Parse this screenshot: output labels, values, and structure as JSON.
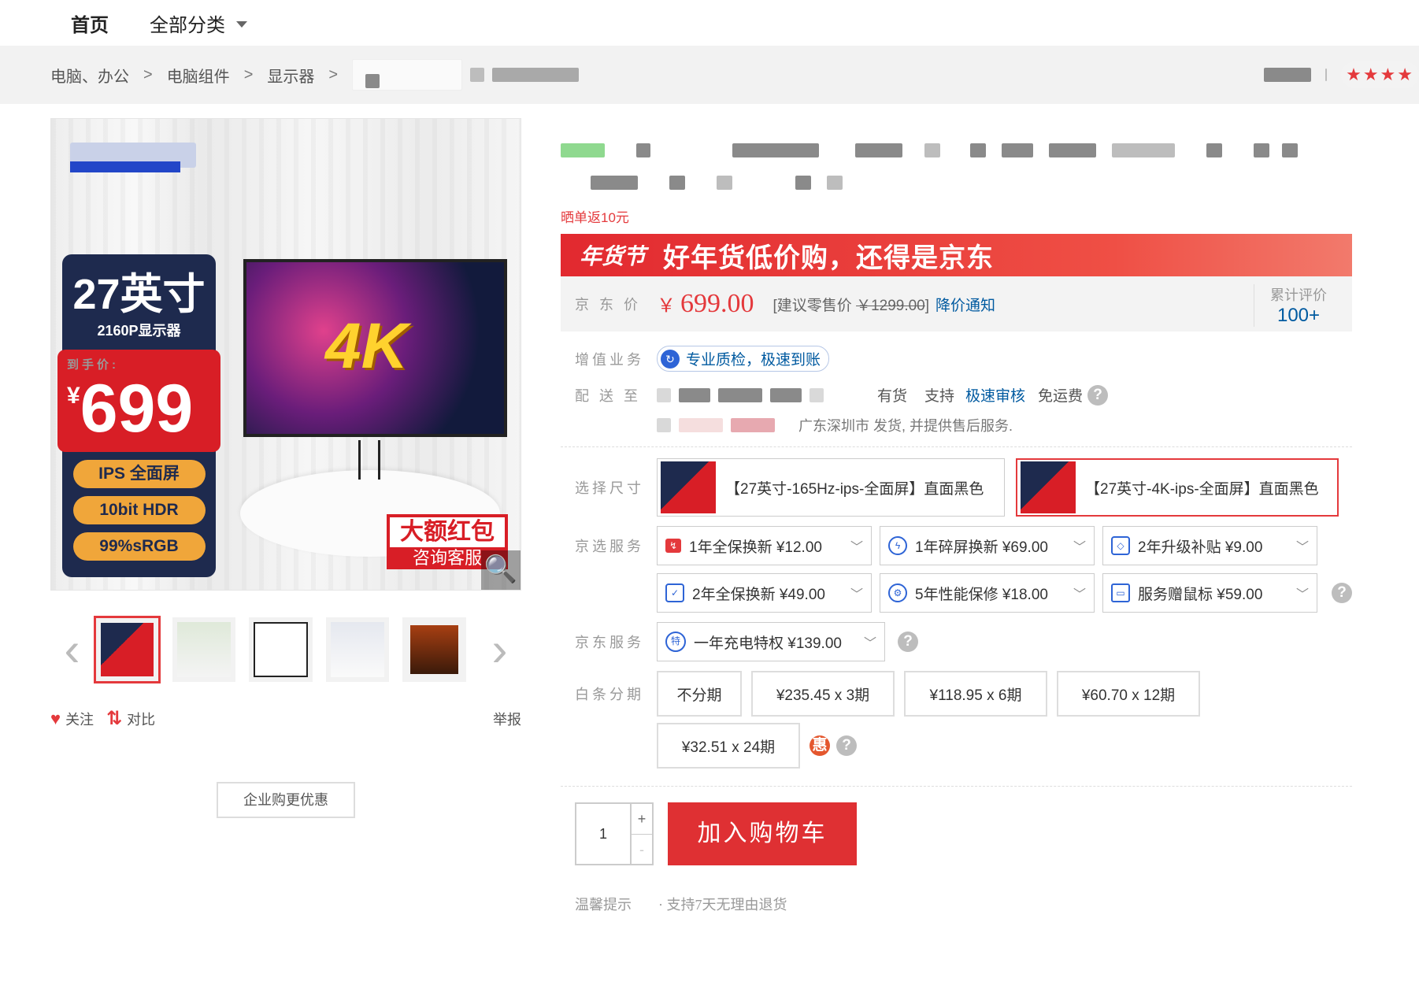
{
  "nav": {
    "home": "首页",
    "all_categories": "全部分类"
  },
  "breadcrumb": {
    "items": [
      "电脑、办公",
      "电脑组件",
      "显示器"
    ],
    "separator": ">"
  },
  "gallery": {
    "promo_size": "27英寸",
    "promo_resolution": "2160P显示器",
    "promo_price_label": "到手价:",
    "promo_currency": "¥",
    "promo_price": "699",
    "promo_features": [
      "IPS 全面屏",
      "10bit HDR",
      "99%sRGB"
    ],
    "monitor_text": "4K",
    "red_packet_title": "大额红包",
    "red_packet_sub": "咨询客服",
    "prev_arrow": "‹",
    "next_arrow": "›",
    "zoom_icon": "🔍"
  },
  "actions": {
    "follow": "关注",
    "compare": "对比",
    "report": "举报",
    "business_button": "企业购更优惠"
  },
  "product": {
    "flash_note": "晒单返10元",
    "banner_tag": "年货节",
    "banner_slogan": "好年货低价购，还得是京东",
    "price_label": "京 东 价",
    "currency": "￥",
    "price": "699.00",
    "msrp_prefix": "[建议零售价 ",
    "msrp_value": "￥1299.00",
    "msrp_suffix": "]",
    "price_notify": "降价通知",
    "review_label": "累计评价",
    "review_count": "100+",
    "vas_label": "增值业务",
    "vas_value": "专业质检，极速到账",
    "delivery_label": "配 送 至",
    "stock": "有货",
    "support": "支持",
    "fast_review": "极速审核",
    "free_shipping": "免运费",
    "ship_from": "广东深圳市 发货, 并提供售后服务.",
    "size_label": "选择尺寸",
    "sizes": [
      "【27英寸-165Hz-ips-全面屏】直面黑色",
      "【27英寸-4K-ips-全面屏】直面黑色"
    ],
    "jx_label": "京选服务",
    "jx_services": [
      "1年全保换新 ¥12.00",
      "1年碎屏换新 ¥69.00",
      "2年升级补贴 ¥9.00",
      "2年全保换新 ¥49.00",
      "5年性能保修 ¥18.00",
      "服务赠鼠标 ¥59.00"
    ],
    "jd_label": "京东服务",
    "jd_service": "一年充电特权 ¥139.00",
    "installment_label": "白条分期",
    "installments": [
      "不分期",
      "¥235.45 x 3期",
      "¥118.95 x 6期",
      "¥60.70 x 12期",
      "¥32.51 x 24期"
    ],
    "discount_badge": "惠",
    "quantity": "1",
    "plus": "+",
    "minus": "-",
    "add_to_cart": "加入购物车",
    "tips_label": "温馨提示",
    "tips": "· 支持7天无理由退货"
  },
  "shop": {
    "stars": "★★★★"
  },
  "colors": {
    "accent": "#e4393c",
    "link": "#005aa0",
    "banner": "#e2292f"
  }
}
